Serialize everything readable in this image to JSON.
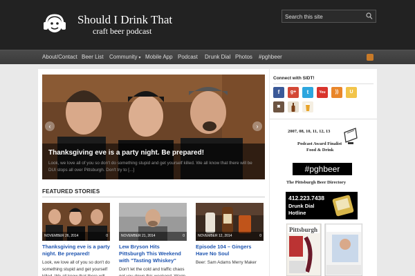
{
  "header": {
    "site_title": "Should I Drink That",
    "tagline": "craft beer podcast",
    "search_placeholder": "Search this site"
  },
  "nav": {
    "items": [
      "About/Contact",
      "Beer List",
      "Community",
      "Mobile App",
      "Podcast",
      "Drunk Dial",
      "Photos",
      "#pghbeer"
    ],
    "community_caret": "▾"
  },
  "slider": {
    "title": "Thanksgiving eve is a party night. Be prepared!",
    "excerpt": "Look, we love all of you so don't do something stupid and get yourself killed. We all know that there will be DUI stops all over Pittsburgh. Don't try to [...]",
    "prev": "‹",
    "next": "›"
  },
  "featured": {
    "heading": "FEATURED STORIES",
    "stories": [
      {
        "date": "NOVEMBER 26, 2014",
        "comments": "0",
        "title": "Thanksgiving eve is a party night. Be prepared!",
        "excerpt": "Look, we love all of you so don't do something stupid and get yourself killed. We all know that there will be"
      },
      {
        "date": "NOVEMBER 21, 2014",
        "comments": "0",
        "title": "Lew Bryson Hits Pittsburgh This Weekend with \"Tasting Whiskey\"",
        "excerpt": "Don't let the cold and traffic chaos get you down this weekend. Warm"
      },
      {
        "date": "NOVEMBER 12, 2014",
        "comments": "0",
        "title": "Episode 104 – Gingers Have No Soul",
        "excerpt": "Beer: Sam Adams Merry Maker"
      }
    ]
  },
  "sidebar": {
    "connect_title": "Connect with SIDT!",
    "social_icons": [
      "facebook-icon",
      "google-plus-icon",
      "twitter-icon",
      "youtube-icon",
      "rss-icon",
      "untappd-icon",
      "instagram-icon",
      "beer-bottle-icon",
      "beer-glass-icon"
    ],
    "award": {
      "years": "2007, 08, 10, 11, 12, 13",
      "line1": "Podcast Award Finalist",
      "line2": "Food & Drink"
    },
    "pghbeer": {
      "tag": "#pghbeer",
      "sub": "The Pittsburgh Beer Directory"
    },
    "drunk_dial": {
      "phone": "412.223.7438",
      "name_line1": "Drunk Dial",
      "name_line2": "Hotline"
    }
  },
  "colors": {
    "header_bg": "#222222",
    "nav_bg": "#444444",
    "link_blue": "#1f55b0",
    "page_bg": "#e9e9e9"
  }
}
